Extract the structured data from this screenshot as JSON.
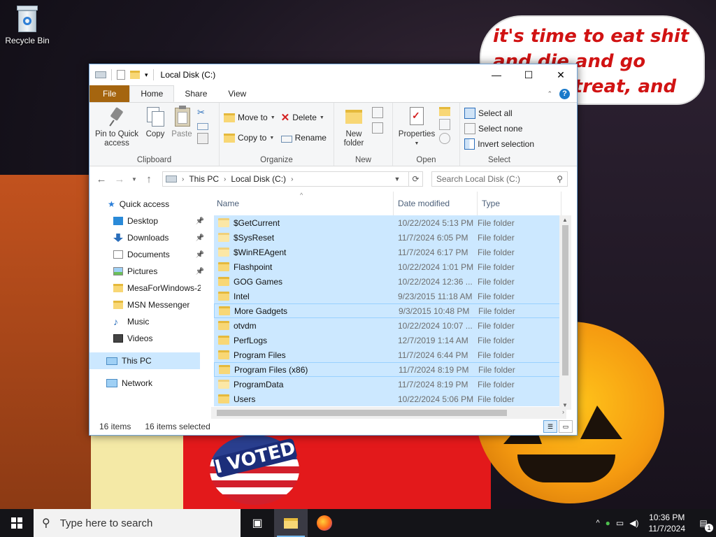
{
  "desktop": {
    "recycle_bin_label": "Recycle Bin",
    "bubble_text": "it's time to eat shit and die and go trick or treat, and vote!",
    "voted_text": "I VOTED"
  },
  "window": {
    "title": "Local Disk (C:)",
    "controls": {
      "minimize": "—",
      "maximize": "☐",
      "close": "✕"
    }
  },
  "ribbon": {
    "tabs": [
      "File",
      "Home",
      "Share",
      "View"
    ],
    "active_tab": "Home",
    "clipboard": {
      "pin_label": "Pin to Quick access",
      "copy_label": "Copy",
      "paste_label": "Paste",
      "group_label": "Clipboard"
    },
    "organize": {
      "move_to": "Move to",
      "copy_to": "Copy to",
      "delete": "Delete",
      "rename": "Rename",
      "group_label": "Organize"
    },
    "new": {
      "new_folder": "New folder",
      "group_label": "New"
    },
    "open": {
      "properties": "Properties",
      "group_label": "Open"
    },
    "select": {
      "select_all": "Select all",
      "select_none": "Select none",
      "invert": "Invert selection",
      "group_label": "Select"
    }
  },
  "address": {
    "crumbs": [
      "This PC",
      "Local Disk (C:)"
    ],
    "search_placeholder": "Search Local Disk (C:)"
  },
  "nav": {
    "quick_access": "Quick access",
    "items": [
      {
        "label": "Desktop",
        "icon": "desktop-icon",
        "pinned": true
      },
      {
        "label": "Downloads",
        "icon": "download-icon",
        "pinned": true
      },
      {
        "label": "Documents",
        "icon": "document-icon",
        "pinned": true
      },
      {
        "label": "Pictures",
        "icon": "picture-icon",
        "pinned": true
      },
      {
        "label": "MesaForWindows-2",
        "icon": "folder-icon",
        "pinned": false
      },
      {
        "label": "MSN Messenger",
        "icon": "folder-icon",
        "pinned": false
      },
      {
        "label": "Music",
        "icon": "music-icon",
        "pinned": false
      },
      {
        "label": "Videos",
        "icon": "video-icon",
        "pinned": false
      }
    ],
    "this_pc": "This PC",
    "network": "Network"
  },
  "list": {
    "columns": {
      "name": "Name",
      "date": "Date modified",
      "type": "Type"
    },
    "rows": [
      {
        "name": "$GetCurrent",
        "date": "10/22/2024 5:13 PM",
        "type": "File folder",
        "ghost": true
      },
      {
        "name": "$SysReset",
        "date": "11/7/2024 6:05 PM",
        "type": "File folder",
        "ghost": true
      },
      {
        "name": "$WinREAgent",
        "date": "11/7/2024 6:17 PM",
        "type": "File folder",
        "ghost": true
      },
      {
        "name": "Flashpoint",
        "date": "10/22/2024 1:01 PM",
        "type": "File folder",
        "ghost": false
      },
      {
        "name": "GOG Games",
        "date": "10/22/2024 12:36 ...",
        "type": "File folder",
        "ghost": false
      },
      {
        "name": "Intel",
        "date": "9/23/2015 11:18 AM",
        "type": "File folder",
        "ghost": false
      },
      {
        "name": "More Gadgets",
        "date": "9/3/2015 10:48 PM",
        "type": "File folder",
        "ghost": false
      },
      {
        "name": "otvdm",
        "date": "10/22/2024 10:07 ...",
        "type": "File folder",
        "ghost": false
      },
      {
        "name": "PerfLogs",
        "date": "12/7/2019 1:14 AM",
        "type": "File folder",
        "ghost": false
      },
      {
        "name": "Program Files",
        "date": "11/7/2024 6:44 PM",
        "type": "File folder",
        "ghost": false
      },
      {
        "name": "Program Files (x86)",
        "date": "11/7/2024 8:19 PM",
        "type": "File folder",
        "ghost": false
      },
      {
        "name": "ProgramData",
        "date": "11/7/2024 8:19 PM",
        "type": "File folder",
        "ghost": true
      },
      {
        "name": "Users",
        "date": "10/22/2024 5:06 PM",
        "type": "File folder",
        "ghost": false
      }
    ]
  },
  "status": {
    "count": "16 items",
    "selected": "16 items selected"
  },
  "taskbar": {
    "search_placeholder": "Type here to search",
    "time": "10:36 PM",
    "date": "11/7/2024",
    "notification_count": "1"
  }
}
